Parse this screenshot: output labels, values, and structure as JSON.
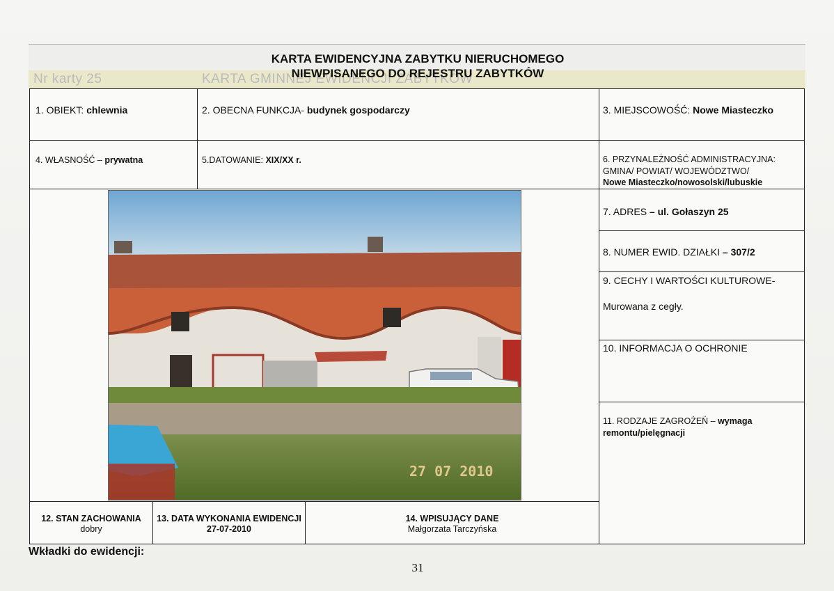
{
  "ghost_header": {
    "card_number": "Nr karty 25",
    "card_title": "KARTA GMINNEJ EWIDENCJI ZABYTKÓW"
  },
  "title": {
    "line1": "KARTA EWIDENCYJNA ZABYTKU NIERUCHOMEGO",
    "line2": "NIEWPISANEGO DO REJESTRU ZABYTKÓW"
  },
  "fields": {
    "obiekt_label": "1. OBIEKT: ",
    "obiekt_value": "chlewnia",
    "funkcja_label": "2. OBECNA FUNKCJA- ",
    "funkcja_value": "budynek gospodarczy",
    "miejscowosc_label": "3. MIEJSCOWOŚĆ: ",
    "miejscowosc_value": "Nowe Miasteczko",
    "wlasnosc_label": "4. WŁASNOŚĆ – ",
    "wlasnosc_value": "prywatna",
    "datowanie_label": "5.DATOWANIE: ",
    "datowanie_value": "XIX/XX r.",
    "przynaleznosc_line1": "6. PRZYNALEŻNOŚĆ ADMINISTRACYJNA:",
    "przynaleznosc_line2": "GMINA/ POWIAT/ WOJEWÓDZTWO/",
    "przynaleznosc_value": "Nowe Miasteczko/nowosolski/lubuskie",
    "adres_label": "7. ADRES ",
    "adres_value": "– ul. Gołaszyn 25",
    "dzialka_label": "8. NUMER EWID. DZIAŁKI ",
    "dzialka_value": "– 307/2",
    "cechy_label": "9. CECHY  I WARTOŚCI KULTUROWE-",
    "cechy_value": "Murowana z cegły.",
    "ochrona_label": "10. INFORMACJA O OCHRONIE",
    "zagrozenia_label": "11. RODZAJE ZAGROŻEŃ –  ",
    "zagrozenia_value1": "wymaga",
    "zagrozenia_value2": "remontu/pielęgnacji"
  },
  "bottom": {
    "stan_label": "12. STAN ZACHOWANIA",
    "stan_value": "dobry",
    "data_label": "13. DATA WYKONANIA EWIDENCJI",
    "data_value": "27-07-2010",
    "wpisujacy_label": "14. WPISUJĄCY DANE",
    "wpisujacy_value": "Małgorzata Tarczyńska"
  },
  "photo": {
    "date_stamp": "27 07 2010"
  },
  "footer": {
    "wkladki": "Wkładki do ewidencji:",
    "page_number": "31"
  },
  "colors": {
    "sky": "#7fb3d8",
    "roof": "#c65a36",
    "wall": "#e9e4dc",
    "grass": "#6f8a3a"
  }
}
